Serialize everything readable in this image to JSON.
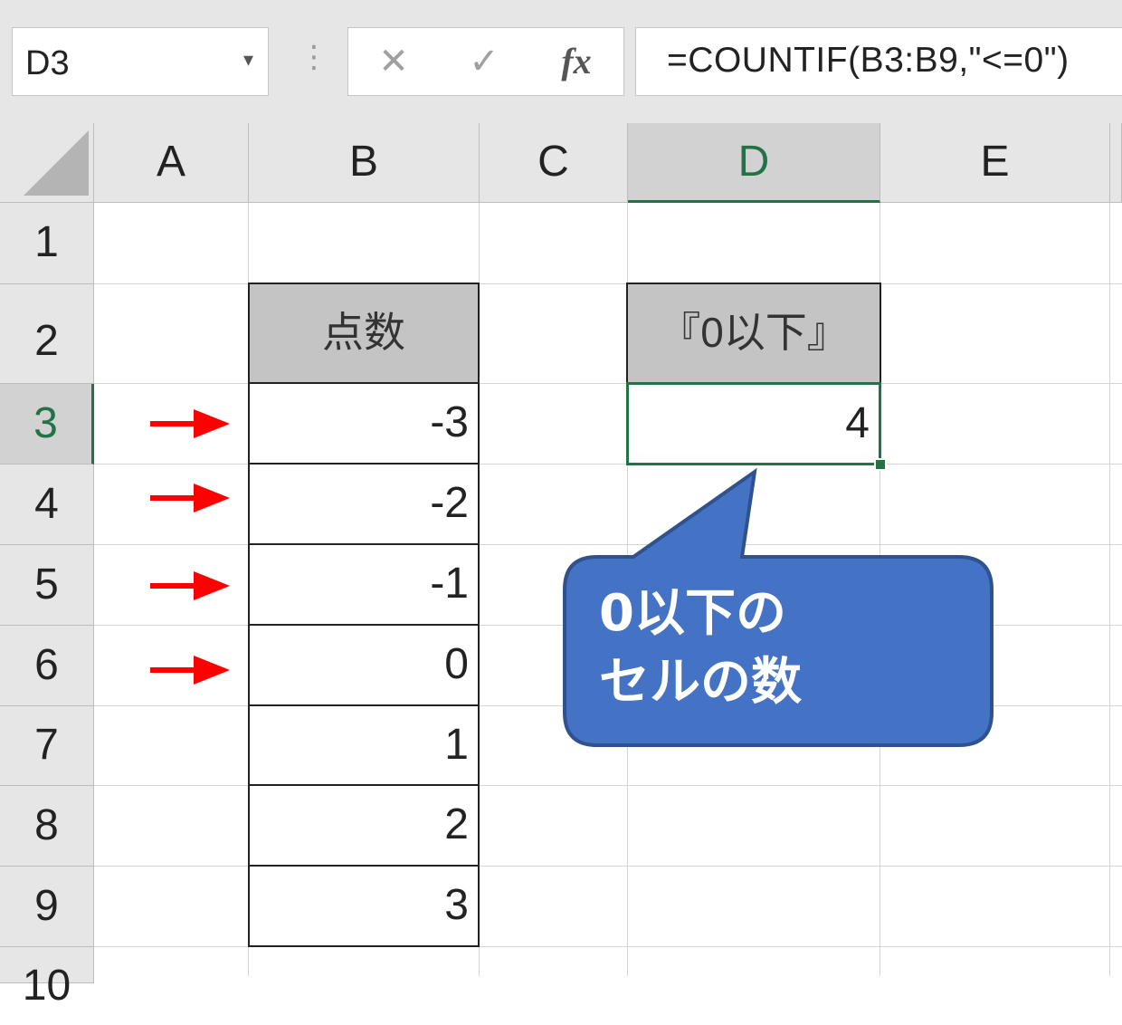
{
  "formula_bar": {
    "name_box": "D3",
    "name_box_dropdown_icon": "chevron-down-icon",
    "grip_icon": "vertical-dots-icon",
    "cancel_icon": "close-icon",
    "enter_icon": "checkmark-icon",
    "fx_label": "fx",
    "formula": "=COUNTIF(B3:B9,\"<=0\")"
  },
  "columns": [
    "A",
    "B",
    "C",
    "D",
    "E"
  ],
  "selected_column": "D",
  "rows": [
    "1",
    "2",
    "3",
    "4",
    "5",
    "6",
    "7",
    "8",
    "9",
    "10"
  ],
  "selected_row": "3",
  "table": {
    "header": "点数",
    "values": [
      "-3",
      "-2",
      "-1",
      "0",
      "1",
      "2",
      "3"
    ]
  },
  "result": {
    "header": "『0以下』",
    "value": "4"
  },
  "arrows": {
    "icon": "right-arrow-icon",
    "color": "#ff0000",
    "rows": [
      "3",
      "4",
      "5",
      "6"
    ]
  },
  "callout": {
    "line1": "0以下の",
    "line2": "セルの数",
    "fill_color": "#4472c4",
    "border_color": "#2f528f"
  },
  "colors": {
    "excel_green": "#217346",
    "header_gray": "#e6e6e6",
    "cell_header_fill": "#c4c4c4"
  }
}
